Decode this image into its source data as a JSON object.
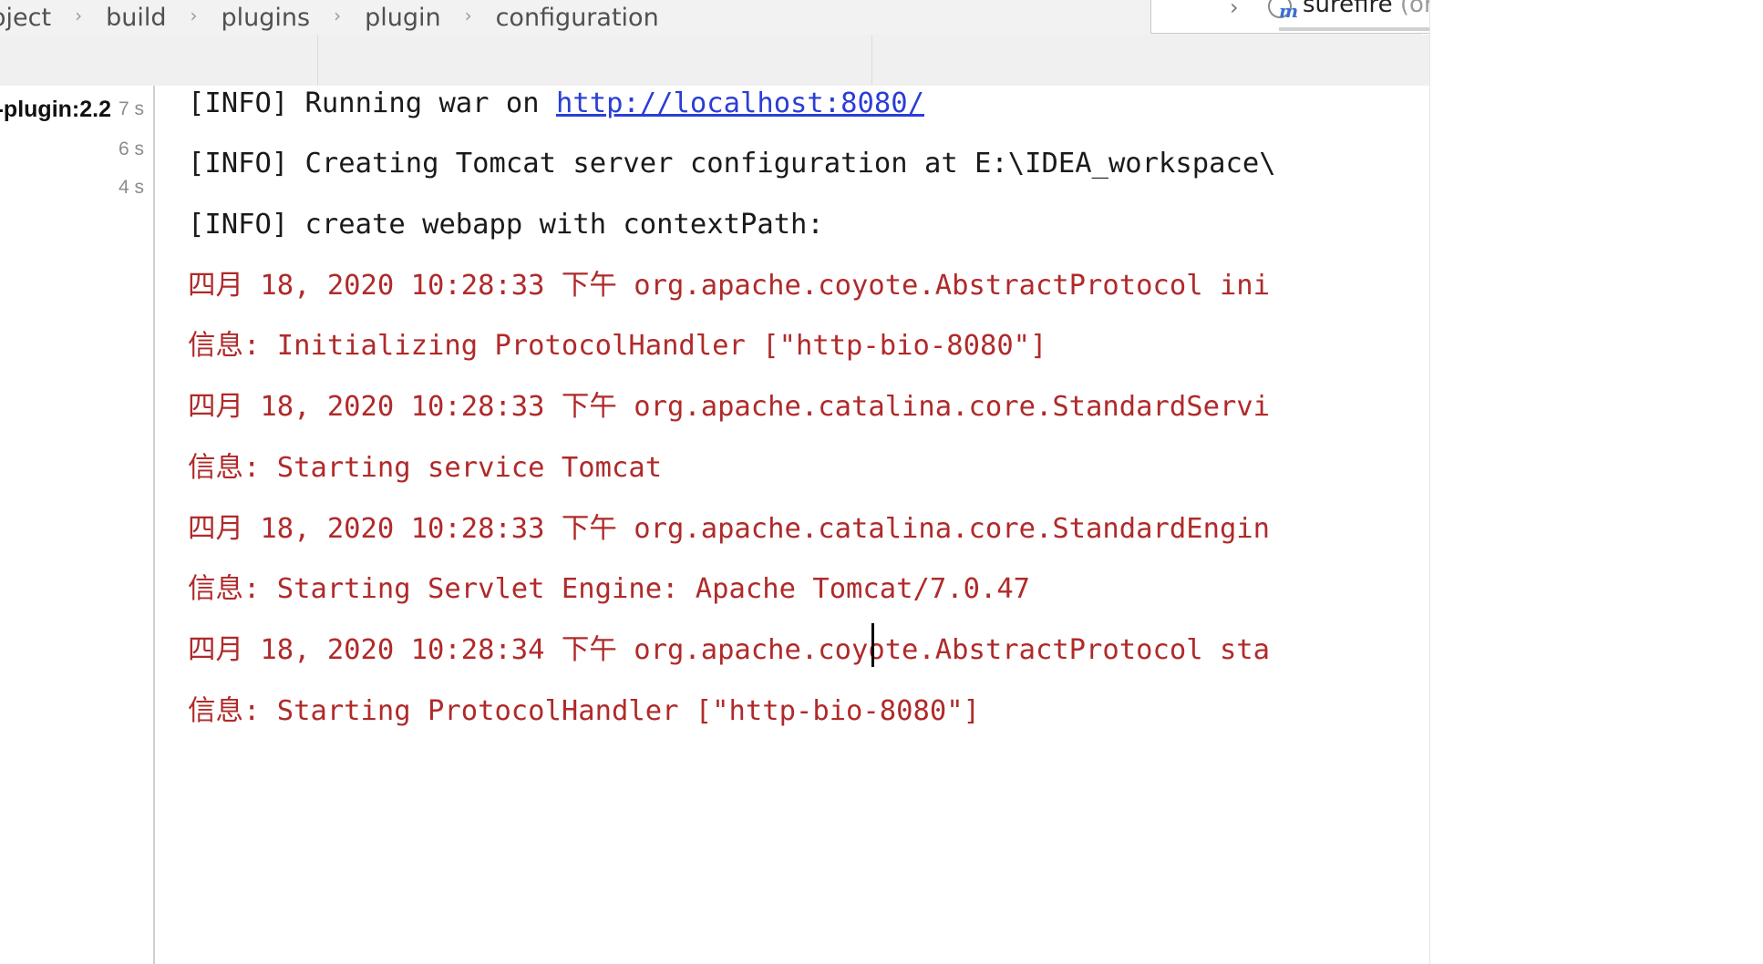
{
  "breadcrumb": {
    "items": [
      "oject",
      "build",
      "plugins",
      "plugin",
      "configuration"
    ],
    "separator": "›"
  },
  "maven_panel": {
    "icon_letter": "m",
    "item_name": "surefire",
    "item_suffix": " (org"
  },
  "build_tree": {
    "rows": [
      {
        "label": "-plugin:2.2",
        "time": "7 s"
      },
      {
        "label": "",
        "time": "6 s"
      },
      {
        "label": "",
        "time": "4 s"
      }
    ]
  },
  "console": {
    "lines": [
      {
        "kind": "info",
        "text": "[INFO] Running war on ",
        "link": "http://localhost:8080/"
      },
      {
        "kind": "info",
        "text": "[INFO] Creating Tomcat server configuration at E:\\IDEA_workspace\\"
      },
      {
        "kind": "info",
        "text": "[INFO] create webapp with contextPath:"
      },
      {
        "kind": "err",
        "text": "四月 18, 2020 10:28:33 下午 org.apache.coyote.AbstractProtocol ini"
      },
      {
        "kind": "err",
        "text": "信息: Initializing ProtocolHandler [\"http-bio-8080\"]"
      },
      {
        "kind": "err",
        "text": "四月 18, 2020 10:28:33 下午 org.apache.catalina.core.StandardServi"
      },
      {
        "kind": "err",
        "text": "信息: Starting service Tomcat"
      },
      {
        "kind": "err",
        "text": "四月 18, 2020 10:28:33 下午 org.apache.catalina.core.StandardEngin"
      },
      {
        "kind": "err",
        "text": "信息: Starting Servlet Engine: Apache Tomcat/7.0.47"
      },
      {
        "kind": "err",
        "text": "四月 18, 2020 10:28:34 下午 org.apache.coyote.AbstractProtocol sta"
      },
      {
        "kind": "err",
        "text": "信息: Starting ProtocolHandler [\"http-bio-8080\"]"
      }
    ]
  },
  "colors": {
    "info_text": "#1a1a1a",
    "error_text": "#b02a2a",
    "link": "#2b3dd6"
  }
}
